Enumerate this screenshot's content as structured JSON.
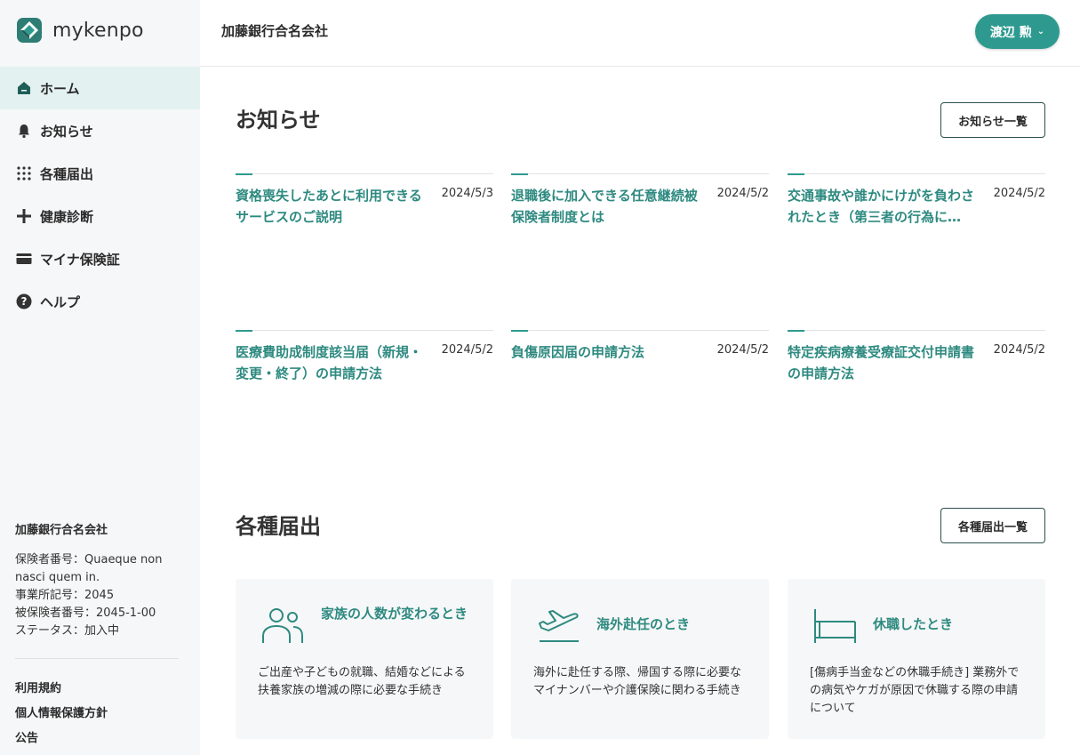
{
  "app": {
    "logo_text": "mykenpo"
  },
  "header": {
    "company": "加藤銀行合名会社",
    "user_name": "渡辺 勲"
  },
  "sidebar": {
    "items": [
      {
        "label": "ホーム",
        "icon": "home-icon",
        "active": true
      },
      {
        "label": "お知らせ",
        "icon": "bell-icon"
      },
      {
        "label": "各種届出",
        "icon": "grid-icon"
      },
      {
        "label": "健康診断",
        "icon": "plus-icon"
      },
      {
        "label": "マイナ保険証",
        "icon": "card-icon"
      },
      {
        "label": "ヘルプ",
        "icon": "help-icon"
      }
    ],
    "info": {
      "company": "加藤銀行合名会社",
      "lines": [
        "保険者番号：Quaeque non nasci quem in.",
        "事業所記号：2045",
        "被保険者番号：2045-1-00",
        "ステータス：加入中"
      ]
    },
    "links": [
      "利用規約",
      "個人情報保護方針",
      "公告"
    ]
  },
  "news": {
    "title": "お知らせ",
    "button": "お知らせ一覧",
    "items": [
      {
        "title": "資格喪失したあとに利用できるサービスのご説明",
        "date": "2024/5/3"
      },
      {
        "title": "退職後に加入できる任意継続被保険者制度とは",
        "date": "2024/5/2"
      },
      {
        "title": "交通事故や誰かにけがを負わされたとき（第三者の行為に…",
        "date": "2024/5/2"
      },
      {
        "title": "医療費助成制度該当届（新規・変更・終了）の申請方法",
        "date": "2024/5/2"
      },
      {
        "title": "負傷原因届の申請方法",
        "date": "2024/5/2"
      },
      {
        "title": "特定疾病療養受療証交付申請書の申請方法",
        "date": "2024/5/2"
      }
    ]
  },
  "forms": {
    "title": "各種届出",
    "button": "各種届出一覧",
    "cards": [
      {
        "title": "家族の人数が変わるとき",
        "icon": "family-icon",
        "desc": "ご出産や子どもの就職、結婚などによる扶養家族の増減の際に必要な手続き"
      },
      {
        "title": "海外赴任のとき",
        "icon": "airplane-icon",
        "desc": "海外に赴任する際、帰国する際に必要なマイナンバーや介護保険に関わる手続き"
      },
      {
        "title": "休職したとき",
        "icon": "bed-icon",
        "desc": "[傷病手当金などの休職手続き] 業務外での病気やケガが原因で休職する際の申請について"
      }
    ]
  },
  "colors": {
    "accent": "#2e9a8f",
    "link": "#2e8a80",
    "sidebar_bg": "#f6f7f8",
    "active_bg": "#e3f2f1"
  }
}
